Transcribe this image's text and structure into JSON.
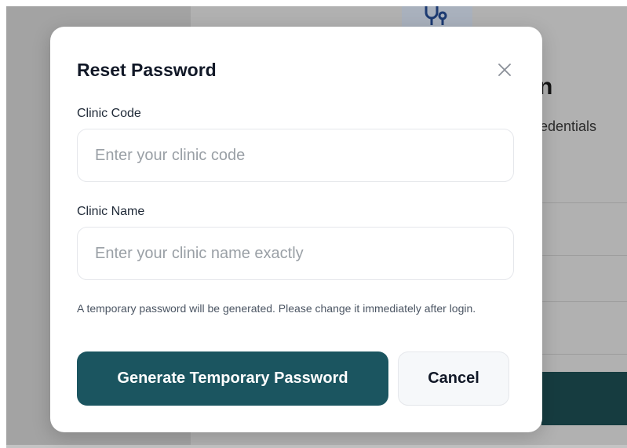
{
  "background": {
    "heading_fragment": "n",
    "subtitle_fragment": "redentials",
    "logo_icon": "stethoscope-icon"
  },
  "modal": {
    "title": "Reset Password",
    "close_icon": "close-icon",
    "fields": [
      {
        "label": "Clinic Code",
        "placeholder": "Enter your clinic code",
        "value": ""
      },
      {
        "label": "Clinic Name",
        "placeholder": "Enter your clinic name exactly",
        "value": ""
      }
    ],
    "hint": "A temporary password will be generated. Please change it immediately after login.",
    "primary_button": "Generate Temporary Password",
    "cancel_button": "Cancel"
  },
  "colors": {
    "primary": "#1b5560",
    "overlay_background": "#b1b1b1",
    "text": "#111827",
    "placeholder": "#9aa0a6"
  }
}
